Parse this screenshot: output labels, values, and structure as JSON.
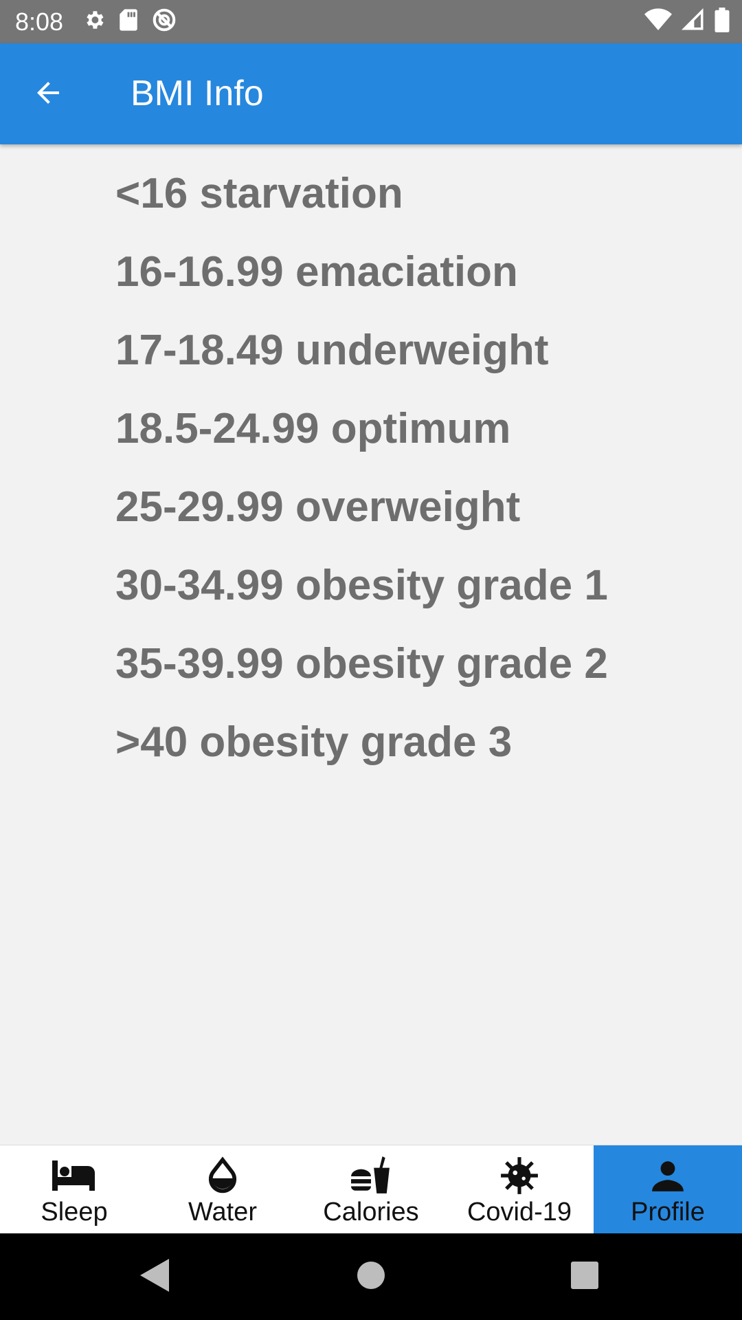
{
  "status_bar": {
    "time": "8:08",
    "left_icons": [
      "settings-icon",
      "sd-card-icon",
      "vpn-icon"
    ],
    "right_icons": [
      "wifi-icon",
      "signal-icon",
      "battery-icon"
    ]
  },
  "app_bar": {
    "title": "BMI Info",
    "back_icon": "arrow-back-icon",
    "color": "#2687de"
  },
  "bmi_ranges": [
    "<16 starvation",
    "16-16.99 emaciation",
    "17-18.49 underweight",
    "18.5-24.99 optimum",
    "25-29.99 overweight",
    "30-34.99 obesity grade 1",
    "35-39.99 obesity grade 2",
    ">40 obesity grade 3"
  ],
  "bottom_nav": {
    "items": [
      {
        "label": "Sleep",
        "icon": "bed-icon"
      },
      {
        "label": "Water",
        "icon": "water-drop-icon"
      },
      {
        "label": "Calories",
        "icon": "fastfood-icon"
      },
      {
        "label": "Covid-19",
        "icon": "virus-icon"
      },
      {
        "label": "Profile",
        "icon": "person-icon"
      }
    ],
    "active": "Profile"
  },
  "system_nav": [
    "back-triangle-icon",
    "home-circle-icon",
    "recents-square-icon"
  ]
}
